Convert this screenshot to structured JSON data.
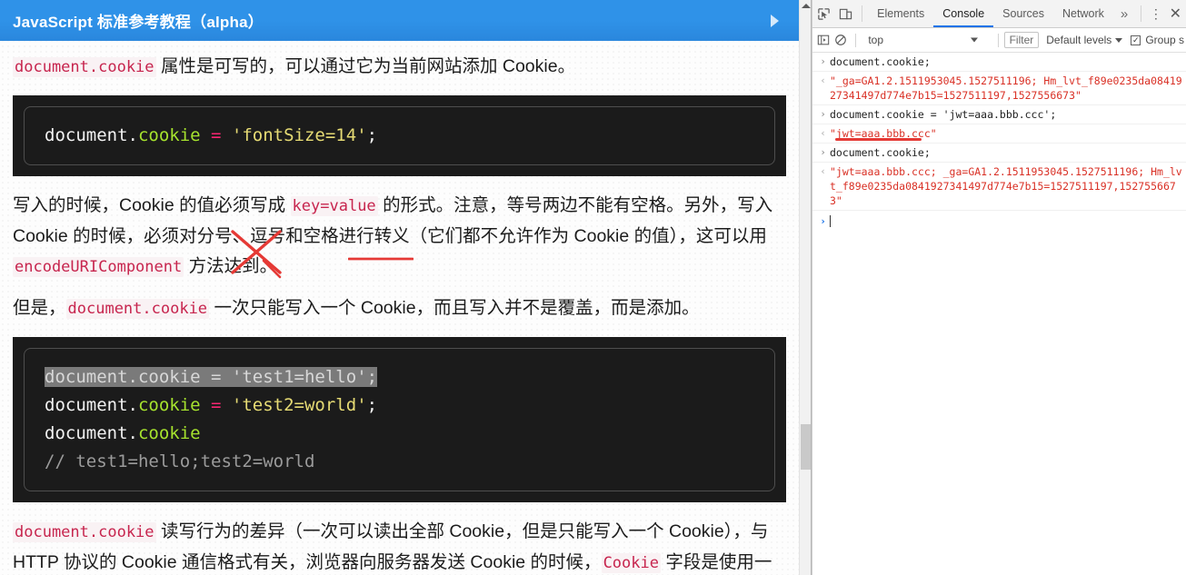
{
  "page": {
    "header": {
      "title": "JavaScript 标准参考教程（alpha）",
      "arrow_icon": "play-triangle-icon"
    },
    "para1": {
      "code": "document.cookie",
      "text": " 属性是可写的，可以通过它为当前网站添加 Cookie。"
    },
    "code_block_1": {
      "lines": [
        [
          {
            "t": "document.",
            "c": "plain"
          },
          {
            "t": "cookie",
            "c": "prop"
          },
          {
            "t": " = ",
            "c": "op"
          },
          {
            "t": "'fontSize=14'",
            "c": "str"
          },
          {
            "t": ";",
            "c": "plain"
          }
        ]
      ]
    },
    "para2": {
      "seg1": "写入的时候，Cookie 的值必须写成 ",
      "code1": "key=value",
      "seg2": " 的形式。注意，等号两边不能有空格。另外，写入 Cookie 的时候，必须对分号、逗号和空格进行转义（它们都不允许作为 Cookie 的值），这可以用 ",
      "code2": "encodeURIComponent",
      "seg3": " 方法达到。"
    },
    "para3": {
      "seg1": "但是，",
      "code1": "document.cookie",
      "seg2": " 一次只能写入一个 Cookie，而且写入并不是覆盖，而是添加。"
    },
    "code_block_2": {
      "lines": [
        [
          {
            "t": "document.",
            "c": "plain sel-start"
          },
          {
            "t": "cookie",
            "c": "prop"
          },
          {
            "t": " = ",
            "c": "op"
          },
          {
            "t": "'test1=hello'",
            "c": "str"
          },
          {
            "t": ";",
            "c": "plain"
          }
        ],
        [
          {
            "t": "document.",
            "c": "plain"
          },
          {
            "t": "cookie",
            "c": "prop"
          },
          {
            "t": " = ",
            "c": "op"
          },
          {
            "t": "'test2=world'",
            "c": "str"
          },
          {
            "t": ";",
            "c": "plain"
          }
        ],
        [
          {
            "t": "document.",
            "c": "plain"
          },
          {
            "t": "cookie",
            "c": "prop"
          }
        ],
        [
          {
            "t": "// test1=hello;test2=world",
            "c": "com"
          }
        ]
      ],
      "selected_line_index": 0
    },
    "para4": {
      "code1": "document.cookie",
      "seg1": " 读写行为的差异（一次可以读出全部 Cookie，但是只能写入一个 Cookie），与 HTTP 协议的 Cookie 通信格式有关，浏览器向服务器发送 Cookie 的时候，",
      "code2": "Cookie",
      "seg2": " 字段是使用一"
    },
    "annotations": {
      "cross_mark": "red-x-annotation",
      "underline": "red-underline-annotation",
      "tail_stroke": "red-stroke-annotation"
    },
    "scrollbar": {
      "up_arrow_icon": "scroll-up-arrow-icon"
    }
  },
  "devtools": {
    "toolbar": {
      "inspect_icon": "inspect-element-icon",
      "device_icon": "device-toolbar-icon",
      "tabs": [
        {
          "label": "Elements",
          "active": false
        },
        {
          "label": "Console",
          "active": true
        },
        {
          "label": "Sources",
          "active": false
        },
        {
          "label": "Network",
          "active": false
        }
      ],
      "more_tabs_icon": "chevron-double-right-icon",
      "more_tabs_label": "»",
      "kebab_icon": "more-options-icon",
      "kebab_label": "⋮",
      "close_icon": "close-icon",
      "close_label": "✕"
    },
    "filterbar": {
      "sidebar_icon": "console-sidebar-icon",
      "clear_icon": "clear-console-icon",
      "context": "top",
      "filter_placeholder": "Filter",
      "levels_label": "Default levels",
      "group_similar_label": "Group s",
      "group_similar_checked": true
    },
    "console": {
      "entries": [
        {
          "kind": "input",
          "marker": "›",
          "text": "document.cookie;"
        },
        {
          "kind": "output",
          "marker": "‹",
          "text": "\"_ga=GA1.2.1511953045.1527511196; Hm_lvt_f89e0235da0841927341497d774e7b15=1527511197,1527556673\""
        },
        {
          "kind": "input",
          "marker": "›",
          "text": "document.cookie = 'jwt=aaa.bbb.ccc';"
        },
        {
          "kind": "output",
          "marker": "‹",
          "text": "\"jwt=aaa.bbb.ccc\"",
          "underlined": true
        },
        {
          "kind": "input",
          "marker": "›",
          "text": "document.cookie;"
        },
        {
          "kind": "output",
          "marker": "‹",
          "text": "\"jwt=aaa.bbb.ccc; _ga=GA1.2.1511953045.1527511196; Hm_lvt_f89e0235da0841927341497d774e7b15=1527511197,1527556673\""
        }
      ],
      "prompt_marker": "›"
    }
  },
  "colors": {
    "header_blue": "#2f92e8",
    "inline_code_red": "#c7254e",
    "console_output_red": "#d93025",
    "annotation_red": "#e53935",
    "code_bg": "#1b1b1b",
    "accent_blue": "#1a73e8"
  }
}
